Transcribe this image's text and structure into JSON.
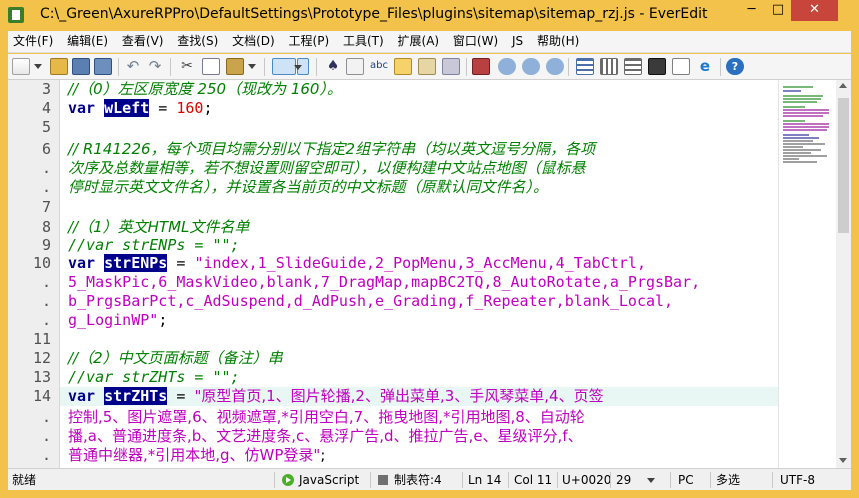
{
  "window": {
    "title": "C:\\_Green\\AxureRPPro\\DefaultSettings\\Prototype_Files\\plugins\\sitemap\\sitemap_rzj.js - EverEdit",
    "minimize_glyph": "─",
    "maximize_glyph": "□",
    "close_glyph": "✕"
  },
  "menu": [
    "文件(F)",
    "编辑(E)",
    "查看(V)",
    "查找(S)",
    "文档(D)",
    "工程(P)",
    "工具(T)",
    "扩展(A)",
    "窗口(W)",
    "JS",
    "帮助(H)"
  ],
  "toolbar_icons": [
    "new-file-icon",
    "open-folder-icon",
    "save-icon",
    "save-all-icon",
    "undo-icon",
    "redo-icon",
    "cut-icon",
    "copy-icon",
    "paste-icon",
    "wrap-icon",
    "find-icon",
    "replace-icon",
    "spell-check-icon",
    "find-in-files-icon",
    "goto-icon",
    "macro-icon",
    "record-icon",
    "play-icon",
    "list-icon",
    "column-icon",
    "outline-icon",
    "window-icon",
    "ie-preview-icon",
    "help-icon"
  ],
  "gutter": [
    {
      "n": "3",
      "row": 0
    },
    {
      "n": "4",
      "row": 1
    },
    {
      "n": "5",
      "row": 2
    },
    {
      "n": "6",
      "row": 3
    },
    {
      "n": ".",
      "row": 4
    },
    {
      "n": ".",
      "row": 5
    },
    {
      "n": "7",
      "row": 6
    },
    {
      "n": "8",
      "row": 7
    },
    {
      "n": "9",
      "row": 8
    },
    {
      "n": "10",
      "row": 9
    },
    {
      "n": ".",
      "row": 10
    },
    {
      "n": ".",
      "row": 11
    },
    {
      "n": ".",
      "row": 12
    },
    {
      "n": "11",
      "row": 13
    },
    {
      "n": "12",
      "row": 14
    },
    {
      "n": "13",
      "row": 15
    },
    {
      "n": "14",
      "row": 16
    },
    {
      "n": ".",
      "row": 17
    },
    {
      "n": ".",
      "row": 18
    },
    {
      "n": ".",
      "row": 19
    }
  ],
  "code": {
    "l3": "//（0）左区原宽度 250（现改为 160）。",
    "l4_kw": "var",
    "l4_var": "wLeft",
    "l4_eq": " = ",
    "l4_num": "160",
    "l4_end": ";",
    "l6a": "// R141226，每个项目均需分别以下指定2组字符串（均以英文逗号分隔，各项",
    "l6b": "次序及总数量相等，若不想设置则留空即可），以便构建中文站点地图（鼠标悬",
    "l6c": "停时显示英文文件名），并设置各当前页的中文标题（原默认同文件名）。",
    "l8": "//（1）英文HTML文件名单",
    "l9": "//var strENPs = \"\";",
    "l10_kw": "var",
    "l10_var": "strENPs",
    "l10_eq": " = ",
    "l10a": "\"index,1_SlideGuide,2_PopMenu,3_AccMenu,4_TabCtrl,",
    "l10b": "5_MaskPic,6_MaskVideo,blank,7_DragMap,mapBC2TQ,8_AutoRotate,a_PrgsBar,",
    "l10c": "b_PrgsBarPct,c_AdSuspend,d_AdPush,e_Grading,f_Repeater,blank_Local,",
    "l10d": "g_LoginWP\"",
    "l10d_end": ";",
    "l12": "//（2）中文页面标题（备注）串",
    "l13": "//var strZHTs = \"\";",
    "l14_kw": "var",
    "l14_var": "strZHTs",
    "l14_eq": " = ",
    "l14a": "\"原型首页,1、图片轮播,2、弹出菜单,3、手风琴菜单,4、页签",
    "l14b": "控制,5、图片遮罩,6、视频遮罩,*引用空白,7、拖曳地图,*引用地图,8、自动轮",
    "l14c": "播,a、普通进度条,b、文艺进度条,c、悬浮广告,d、推拉广告,e、星级评分,f、",
    "l14d": "普通中继器,*引用本地,g、仿WP登录\"",
    "l14d_end": ";"
  },
  "status": {
    "state": "就绪",
    "language": "JavaScript",
    "tab": "制表符:4",
    "line": "Ln 14",
    "col": "Col 11",
    "codepoint": "U+0020",
    "number": "29",
    "eol": "PC",
    "mode": "多选",
    "encoding": "UTF-8"
  }
}
